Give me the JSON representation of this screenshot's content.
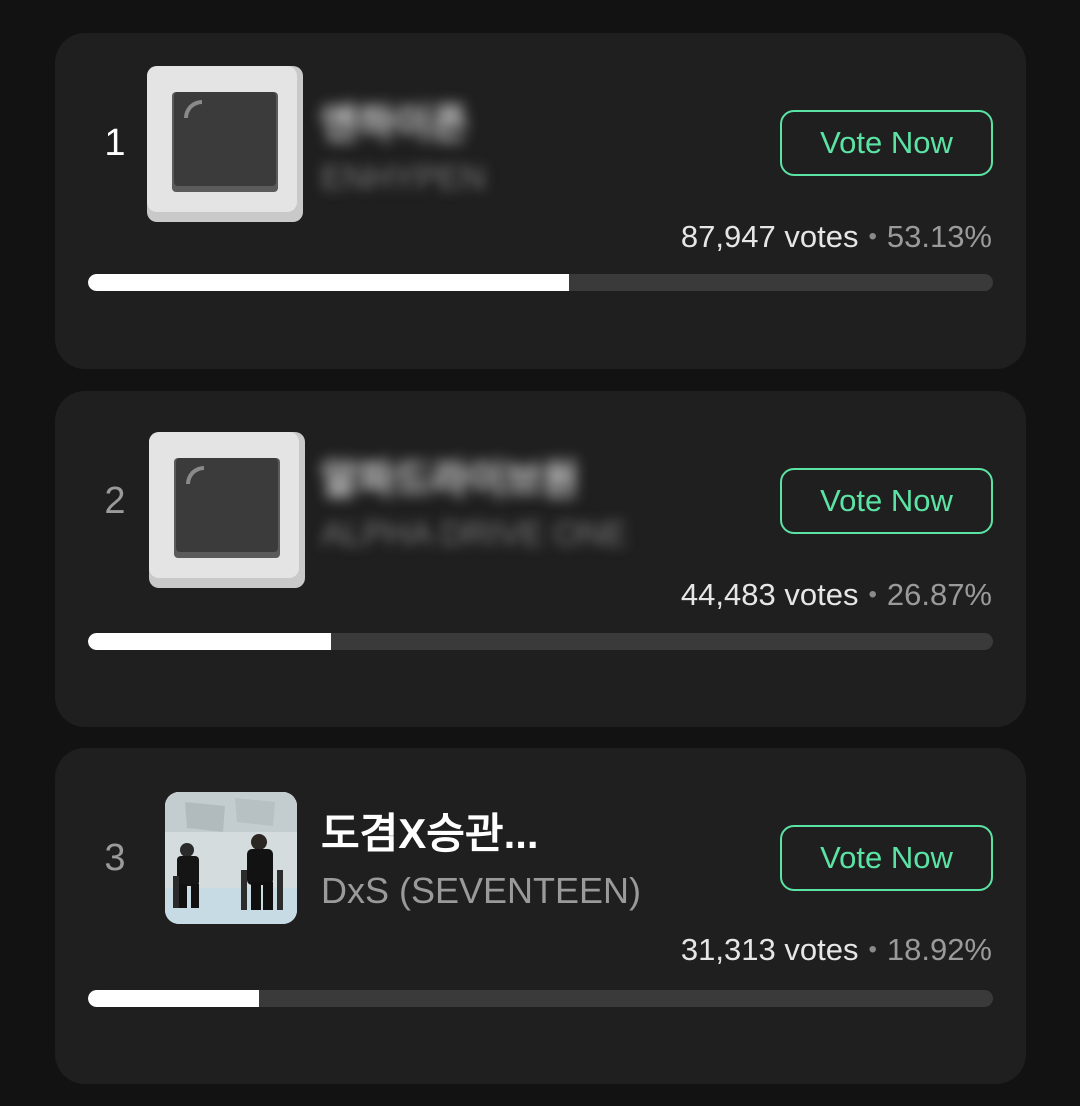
{
  "items": [
    {
      "rank": "1",
      "title": "엔하이픈",
      "artist": "ENHYPEN",
      "artwork": "placeholder-image-icon",
      "vote_button": "Vote Now",
      "votes": "87,947 votes",
      "separator": "•",
      "percent": "53.13%",
      "progress": 0.5313
    },
    {
      "rank": "2",
      "title": "알파드라이브원",
      "artist": "ALPHA DRIVE ONE",
      "artwork": "placeholder-image-icon",
      "vote_button": "Vote Now",
      "votes": "44,483 votes",
      "separator": "•",
      "percent": "26.87%",
      "progress": 0.2687
    },
    {
      "rank": "3",
      "title": "도겸X승관...",
      "artist": "DxS (SEVENTEEN)",
      "artwork": "album-photo",
      "vote_button": "Vote Now",
      "votes": "31,313 votes",
      "separator": "•",
      "percent": "18.92%",
      "progress": 0.1892
    }
  ],
  "colors": {
    "accent": "#5be3a4",
    "card_background": "#1f1f1f",
    "page_background": "#121212",
    "bar_fill": "#ffffff",
    "bar_track": "#3a3a3a"
  }
}
